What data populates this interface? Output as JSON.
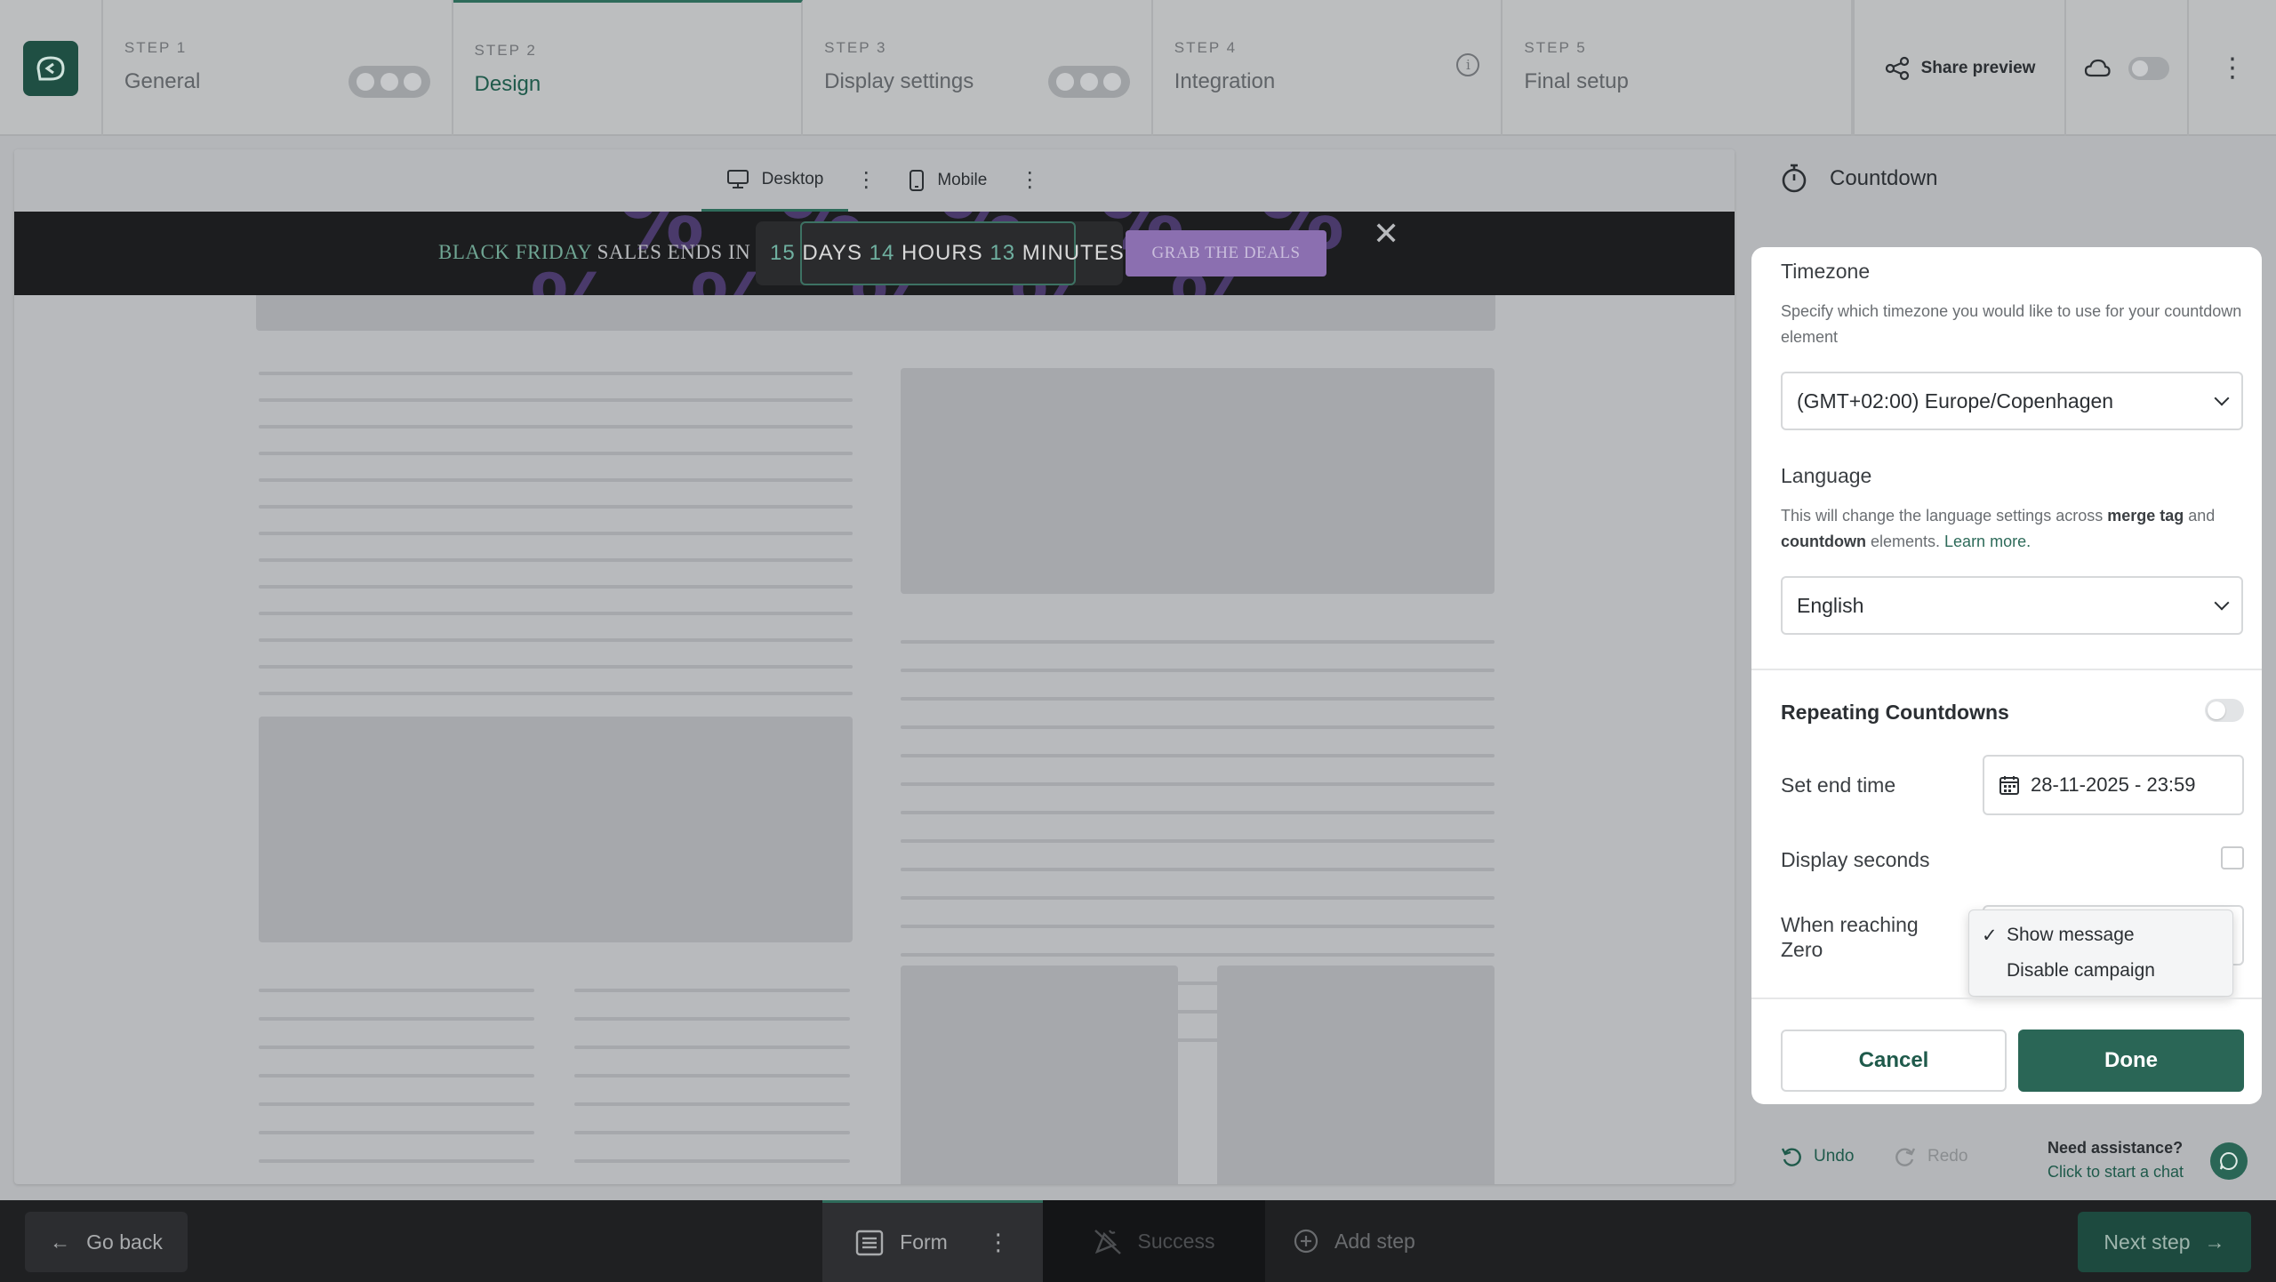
{
  "stepper": {
    "steps": [
      {
        "num": "STEP 1",
        "name": "General"
      },
      {
        "num": "STEP 2",
        "name": "Design"
      },
      {
        "num": "STEP 3",
        "name": "Display settings"
      },
      {
        "num": "STEP 4",
        "name": "Integration"
      },
      {
        "num": "STEP 5",
        "name": "Final setup"
      }
    ],
    "active_index": 1,
    "share_label": "Share preview"
  },
  "canvas": {
    "device_tabs": [
      "Desktop",
      "Mobile"
    ],
    "active_device": "Desktop",
    "banner": {
      "prefix_green": "BLACK FRIDAY",
      "prefix_rest": " SALES ENDS IN",
      "days_num": "15",
      "days_label": "DAYS",
      "hours_num": "14",
      "hours_label": "HOURS",
      "minutes_num": "13",
      "minutes_label": "MINUTES",
      "cta": "GRAB THE DEALS",
      "pattern_glyph": "%"
    }
  },
  "panel": {
    "title": "Countdown",
    "timezone": {
      "label": "Timezone",
      "description": "Specify which timezone you would like to use for your countdown element",
      "value": "(GMT+02:00) Europe/Copenhagen"
    },
    "language": {
      "label": "Language",
      "desc_part1": "This will change the language settings across ",
      "desc_bold1": "merge tag",
      "desc_part2": " and ",
      "desc_bold2": "countdown",
      "desc_part3": " elements. ",
      "desc_link": "Learn more.",
      "value": "English"
    },
    "repeating": {
      "label": "Repeating Countdowns",
      "enabled": false
    },
    "end_time": {
      "label": "Set end time",
      "value": "28-11-2025 - 23:59"
    },
    "display_seconds": {
      "label": "Display seconds",
      "checked": false
    },
    "zero": {
      "label_line1": "When reaching",
      "label_line2": "Zero",
      "options": [
        "Show message",
        "Disable campaign"
      ],
      "selected": "Show message",
      "check_glyph": "✓"
    },
    "cancel_label": "Cancel",
    "done_label": "Done"
  },
  "history": {
    "undo": "Undo",
    "redo": "Redo"
  },
  "assist": {
    "line1": "Need assistance?",
    "line2": "Click to start a chat"
  },
  "bottom": {
    "go_back": "Go back",
    "tabs": [
      "Form",
      "Success"
    ],
    "add_step": "Add step",
    "next_step": "Next step"
  },
  "colors": {
    "brand": "#2a6656",
    "banner_bg": "#1c1d1f",
    "cta": "#8b6fb0"
  }
}
